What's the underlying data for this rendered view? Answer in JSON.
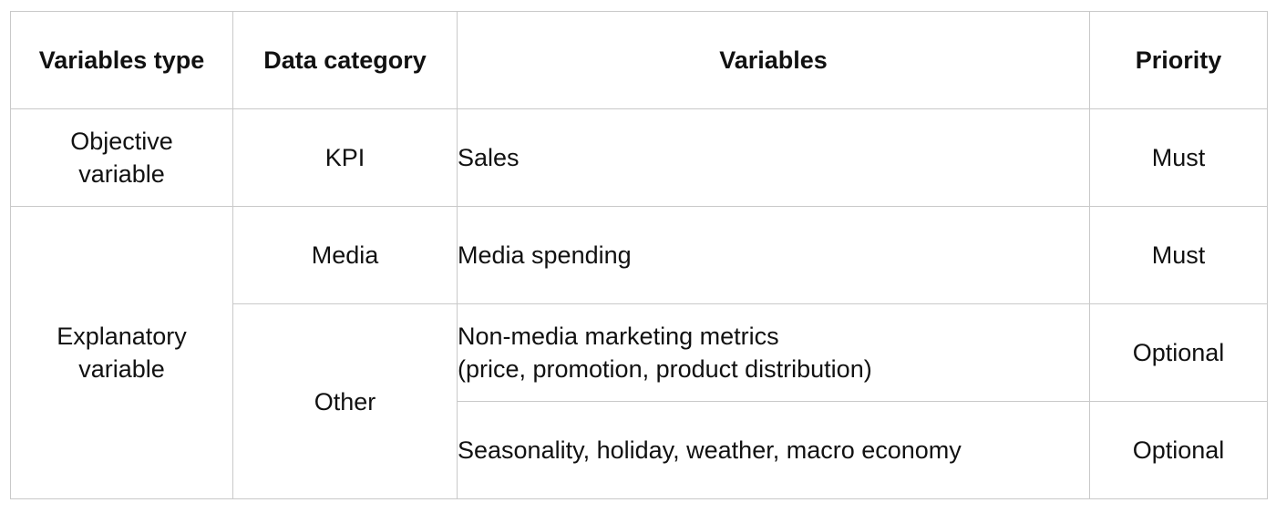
{
  "header": {
    "variables_type": "Variables type",
    "data_category": "Data category",
    "variables": "Variables",
    "priority": "Priority"
  },
  "rows": [
    {
      "variables_type_line1": "Objective",
      "variables_type_line2": "variable",
      "data_category": "KPI",
      "variables": "Sales",
      "priority": "Must"
    },
    {
      "variables_type_line1": "Explanatory",
      "variables_type_line2": "variable",
      "data_category": "Media",
      "variables": "Media spending",
      "priority": "Must"
    },
    {
      "data_category": "Other",
      "variables_line1": "Non-media marketing metrics",
      "variables_line2": "(price, promotion, product distribution)",
      "priority": "Optional"
    },
    {
      "variables": "Seasonality, holiday, weather, macro economy",
      "priority": "Optional"
    }
  ],
  "colors": {
    "header_text": "#5a8494",
    "border": "#c9c9c9",
    "body_text": "#111111"
  }
}
